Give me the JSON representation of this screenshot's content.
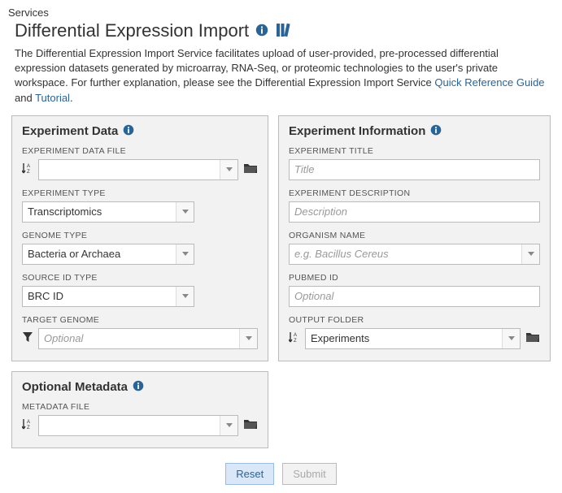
{
  "breadcrumb": "Services",
  "title": "Differential Expression Import",
  "intro": {
    "text_before": "The Differential Expression Import Service facilitates upload of user-provided, pre-processed differential expression datasets generated by microarray, RNA-Seq, or proteomic technologies to the user's private workspace. For further explanation, please see the Differential Expression Import Service ",
    "link1": "Quick Reference Guide",
    "between": " and ",
    "link2": "Tutorial",
    "after": "."
  },
  "panels": {
    "exp_data": {
      "title": "Experiment Data",
      "fields": {
        "data_file": {
          "label": "EXPERIMENT DATA FILE",
          "value": ""
        },
        "exp_type": {
          "label": "EXPERIMENT TYPE",
          "value": "Transcriptomics"
        },
        "genome_type": {
          "label": "GENOME TYPE",
          "value": "Bacteria or Archaea"
        },
        "source_id": {
          "label": "SOURCE ID TYPE",
          "value": "BRC ID"
        },
        "target_genome": {
          "label": "TARGET GENOME",
          "value": "",
          "placeholder": "Optional"
        }
      }
    },
    "exp_info": {
      "title": "Experiment Information",
      "fields": {
        "exp_title": {
          "label": "EXPERIMENT TITLE",
          "value": "",
          "placeholder": "Title"
        },
        "exp_desc": {
          "label": "EXPERIMENT DESCRIPTION",
          "value": "",
          "placeholder": "Description"
        },
        "organism": {
          "label": "ORGANISM NAME",
          "value": "",
          "placeholder": "e.g. Bacillus Cereus"
        },
        "pubmed": {
          "label": "PUBMED ID",
          "value": "",
          "placeholder": "Optional"
        },
        "out_folder": {
          "label": "OUTPUT FOLDER",
          "value": "Experiments"
        }
      }
    },
    "optional_meta": {
      "title": "Optional Metadata",
      "fields": {
        "meta_file": {
          "label": "METADATA FILE",
          "value": ""
        }
      }
    }
  },
  "buttons": {
    "reset": "Reset",
    "submit": "Submit"
  }
}
